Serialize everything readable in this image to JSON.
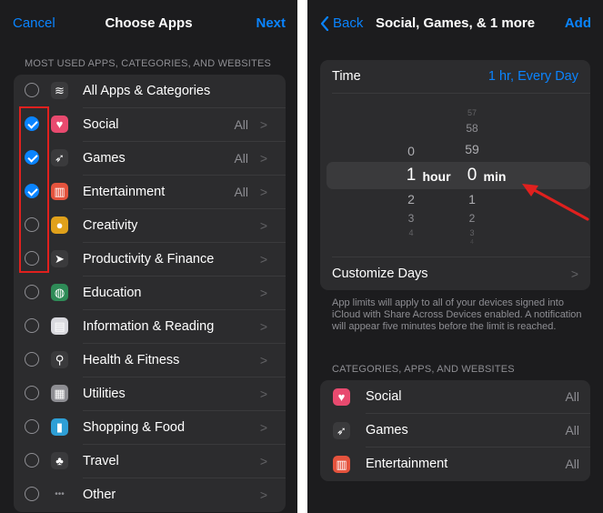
{
  "left": {
    "nav": {
      "cancel": "Cancel",
      "title": "Choose Apps",
      "next": "Next"
    },
    "section_header": "MOST USED APPS, CATEGORIES, AND WEBSITES",
    "rows": [
      {
        "label": "All Apps & Categories",
        "value": "",
        "checked": false,
        "icon": "stack-icon",
        "glyph": "≋",
        "color": "#3a3a3c",
        "chev": false
      },
      {
        "label": "Social",
        "value": "All",
        "checked": true,
        "icon": "social-icon",
        "glyph": "♥",
        "color": "#e84a6f",
        "chev": true
      },
      {
        "label": "Games",
        "value": "All",
        "checked": true,
        "icon": "rocket-icon",
        "glyph": "➶",
        "color": "#3a3a3c",
        "chev": true
      },
      {
        "label": "Entertainment",
        "value": "All",
        "checked": true,
        "icon": "popcorn-icon",
        "glyph": "▥",
        "color": "#e5533d",
        "chev": true
      },
      {
        "label": "Creativity",
        "value": "",
        "checked": false,
        "icon": "palette-icon",
        "glyph": "●",
        "color": "#e0a11b",
        "chev": true
      },
      {
        "label": "Productivity & Finance",
        "value": "",
        "checked": false,
        "icon": "paper-plane-icon",
        "glyph": "➤",
        "color": "#3a3a3c",
        "chev": true
      },
      {
        "label": "Education",
        "value": "",
        "checked": false,
        "icon": "globe-icon",
        "glyph": "◍",
        "color": "#2e8b57",
        "chev": true
      },
      {
        "label": "Information & Reading",
        "value": "",
        "checked": false,
        "icon": "book-icon",
        "glyph": "▤",
        "color": "#d9d9de",
        "chev": true
      },
      {
        "label": "Health & Fitness",
        "value": "",
        "checked": false,
        "icon": "bicycle-icon",
        "glyph": "⚲",
        "color": "#3a3a3c",
        "chev": true
      },
      {
        "label": "Utilities",
        "value": "",
        "checked": false,
        "icon": "calculator-icon",
        "glyph": "▦",
        "color": "#8e8e93",
        "chev": true
      },
      {
        "label": "Shopping & Food",
        "value": "",
        "checked": false,
        "icon": "shopping-bag-icon",
        "glyph": "▮",
        "color": "#2e9fd6",
        "chev": true
      },
      {
        "label": "Travel",
        "value": "",
        "checked": false,
        "icon": "palm-tree-icon",
        "glyph": "♣",
        "color": "#3a3a3c",
        "chev": true
      },
      {
        "label": "Other",
        "value": "",
        "checked": false,
        "icon": "ellipsis-icon",
        "glyph": "•••",
        "color": "#3a3a3c",
        "chev": true
      }
    ]
  },
  "right": {
    "nav": {
      "back": "Back",
      "title": "Social, Games, & 1 more",
      "add": "Add"
    },
    "time_label": "Time",
    "time_value": "1 hr, Every Day",
    "picker": {
      "hours": [
        "0",
        "1",
        "2",
        "3",
        "4"
      ],
      "minutes": [
        "57",
        "58",
        "59",
        "0",
        "1",
        "2",
        "3",
        "4"
      ],
      "hour_unit": "hour",
      "min_unit": "min"
    },
    "customize_days": "Customize Days",
    "footer": "App limits will apply to all of your devices signed into iCloud with Share Across Devices enabled. A notification will appear five minutes before the limit is reached.",
    "section_header": "CATEGORIES, APPS, AND WEBSITES",
    "rows": [
      {
        "label": "Social",
        "value": "All",
        "icon": "social-icon",
        "glyph": "♥",
        "color": "#e84a6f"
      },
      {
        "label": "Games",
        "value": "All",
        "icon": "rocket-icon",
        "glyph": "➶",
        "color": "#3a3a3c"
      },
      {
        "label": "Entertainment",
        "value": "All",
        "icon": "popcorn-icon",
        "glyph": "▥",
        "color": "#e5533d"
      }
    ]
  },
  "colors": {
    "accent": "#0a84ff",
    "highlight": "#e0201e",
    "background": "#1c1c1e",
    "cell": "#2c2c2e"
  }
}
